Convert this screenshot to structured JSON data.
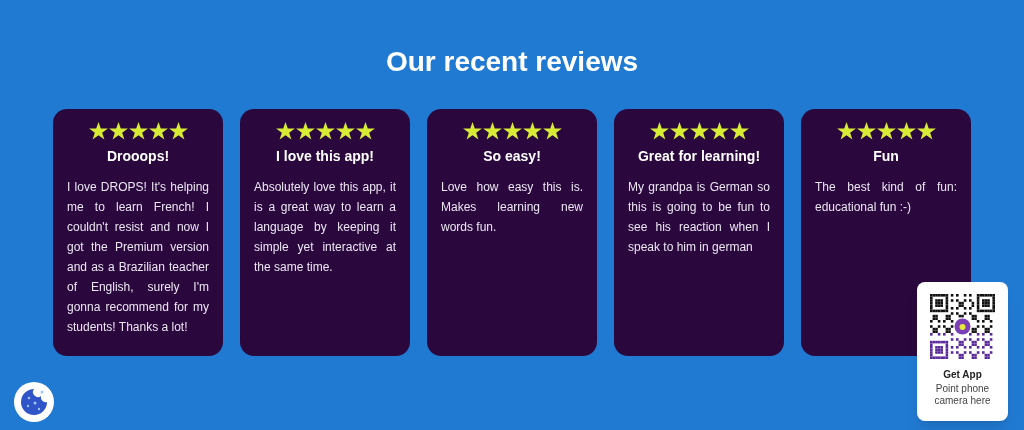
{
  "heading": "Our recent reviews",
  "reviews": [
    {
      "stars": 5,
      "title": "Drooops!",
      "text": "I love DROPS! It's helping me to learn French! I couldn't resist and now I got the Premium version and as a Brazilian teacher of English, surely I'm gonna recommend for my students! Thanks a lot!"
    },
    {
      "stars": 5,
      "title": "I love this app!",
      "text": "Absolutely love this app, it is a great way to learn a language by keeping it simple yet interactive at the same time."
    },
    {
      "stars": 5,
      "title": "So easy!",
      "text": "Love how easy this is. Makes learning new words fun."
    },
    {
      "stars": 5,
      "title": "Great for learning!",
      "text": "My grandpa is German so this is going to be fun to see his reaction when I speak to him in german"
    },
    {
      "stars": 5,
      "title": "Fun",
      "text": "The best kind of fun: educational fun :-)"
    }
  ],
  "get_app": {
    "title": "Get App",
    "subtitle": "Point phone camera here"
  }
}
